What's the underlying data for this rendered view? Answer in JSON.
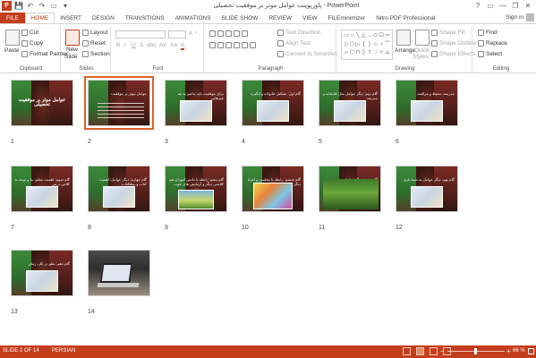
{
  "window": {
    "title": "پاورپوینت عوامل موثر بر موفقیت تحصیلی - PowerPoint",
    "controls": [
      "?",
      "▭",
      "—",
      "❐",
      "✕"
    ]
  },
  "qat": {
    "logo": "P",
    "save_icon": "save-icon",
    "undo_icon": "undo-icon",
    "redo_icon": "redo-icon",
    "slideshow_icon": "start-slideshow-icon",
    "customize_icon": "customize-qat-icon"
  },
  "tabs": [
    "FILE",
    "HOME",
    "INSERT",
    "DESIGN",
    "TRANSITIONS",
    "ANIMATIONS",
    "SLIDE SHOW",
    "REVIEW",
    "VIEW",
    "FILEminimizer",
    "Nitro PDF Professional"
  ],
  "active_tab": "HOME",
  "account": {
    "signin": "Sign in"
  },
  "ribbon": {
    "clipboard": {
      "paste": "Paste",
      "cut": "Cut",
      "copy": "Copy",
      "format_painter": "Format Painter",
      "label": "Clipboard"
    },
    "slides": {
      "new_slide": "New",
      "new_slide2": "Slide",
      "layout": "Layout",
      "reset": "Reset",
      "section": "Section",
      "label": "Slides"
    },
    "font": {
      "label": "Font",
      "bold": "B",
      "italic": "I",
      "underline": "U",
      "strike": "S",
      "shadow": "abc",
      "spacing": "AV",
      "case": "Aa",
      "color": "A"
    },
    "paragraph": {
      "label": "Paragraph",
      "text_direction": "Text Direction",
      "align_text": "Align Text",
      "smartart": "Convert to SmartArt"
    },
    "drawing": {
      "label": "Drawing",
      "arrange": "Arrange",
      "quick_styles": "Quick",
      "quick_styles2": "Styles",
      "shape_fill": "Shape Fill",
      "shape_outline": "Shape Outline",
      "shape_effects": "Shape Effects"
    },
    "editing": {
      "label": "Editing",
      "find": "Find",
      "replace": "Replace",
      "select": "Select"
    }
  },
  "slides": [
    {
      "n": "1",
      "caption": "عوامل موثر بر موفقیت تحصیلی",
      "style": "title"
    },
    {
      "n": "2",
      "caption": "عوامل موثر بر موفقیت",
      "style": "text"
    },
    {
      "n": "3",
      "caption": "برای موفقیت باید بدانیم به چه چیزهایی",
      "style": "pic"
    },
    {
      "n": "4",
      "caption": "گام اول: تشکیل خانواده و انگیزه",
      "style": "pic"
    },
    {
      "n": "5",
      "caption": "گام دوم: دیگر عوامل مثل کتابخانه و مدرسه",
      "style": "pic"
    },
    {
      "n": "6",
      "caption": "مدرسه، محیط و مراقبت",
      "style": "pic"
    },
    {
      "n": "7",
      "caption": "گام سوم: اهمیت معلم، ما و توجه به کلاس درس",
      "style": "pic"
    },
    {
      "n": "8",
      "caption": "گام چهارم: دیگر عوامل: اهمیت کتاب و مطالعات",
      "style": "pic"
    },
    {
      "n": "9",
      "caption": "گام پنجم: رابطه با دانش آموزان هم کلاسی دیگر و آزمایش های خوب",
      "style": "nature"
    },
    {
      "n": "10",
      "caption": "گام ششم: رابطه با معلمین و افراد دیگر",
      "style": "cartoon"
    },
    {
      "n": "11",
      "caption": "گام هفتم: دیگر عوامل در مسیر موفقیت و پیشرفت",
      "style": "forest"
    },
    {
      "n": "12",
      "caption": "گام نهم: دیگر عوامل به شما یاری",
      "style": "pic"
    },
    {
      "n": "13",
      "caption": "گام دهم: نظم در کار، زمان",
      "style": "pic"
    },
    {
      "n": "14",
      "caption": "",
      "style": "laptop"
    }
  ],
  "status": {
    "slide_of": "SLIDE 2 OF 14",
    "language": "PERSIAN",
    "zoom": "66 %"
  },
  "colors": {
    "accent": "#c43e1c",
    "selection": "#e0612a"
  }
}
